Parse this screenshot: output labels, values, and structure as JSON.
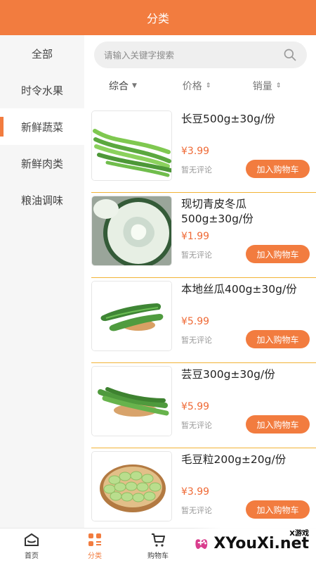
{
  "header": {
    "title": "分类"
  },
  "sidebar": {
    "items": [
      {
        "label": "全部"
      },
      {
        "label": "时令水果"
      },
      {
        "label": "新鲜蔬菜",
        "active": true
      },
      {
        "label": "新鲜肉类"
      },
      {
        "label": "粮油调味"
      }
    ]
  },
  "search": {
    "placeholder": "请输入关键字搜索"
  },
  "sort": {
    "items": [
      {
        "label": "综合",
        "icon": "caret-down-icon"
      },
      {
        "label": "价格",
        "icon": "sort-icon"
      },
      {
        "label": "销量",
        "icon": "sort-icon"
      }
    ]
  },
  "products": [
    {
      "name": "长豆500g±30g/份",
      "price": "¥3.99",
      "reviews": "暂无评论",
      "button": "加入购物车",
      "image": "long-bean"
    },
    {
      "name": "现切青皮冬瓜\n500g±30g/份",
      "price": "¥1.99",
      "reviews": "暂无评论",
      "button": "加入购物车",
      "image": "winter-melon"
    },
    {
      "name": "本地丝瓜400g±30g/份",
      "price": "¥5.99",
      "reviews": "暂无评论",
      "button": "加入购物车",
      "image": "loofah"
    },
    {
      "name": "芸豆300g±30g/份",
      "price": "¥5.99",
      "reviews": "暂无评论",
      "button": "加入购物车",
      "image": "kidney-bean"
    },
    {
      "name": "毛豆粒200g±20g/份",
      "price": "¥3.99",
      "reviews": "暂无评论",
      "button": "加入购物车",
      "image": "edamame"
    }
  ],
  "tabbar": {
    "items": [
      {
        "label": "首页",
        "icon": "home-icon"
      },
      {
        "label": "分类",
        "icon": "category-icon",
        "active": true
      },
      {
        "label": "购物车",
        "icon": "cart-icon"
      },
      {
        "label": "",
        "icon": ""
      },
      {
        "label": "",
        "icon": ""
      }
    ]
  },
  "watermark": {
    "small": "X游戏",
    "main": "XYouXi.net"
  },
  "colors": {
    "accent": "#f27c3f",
    "price": "#ef6a36",
    "divider": "#f2b336"
  }
}
